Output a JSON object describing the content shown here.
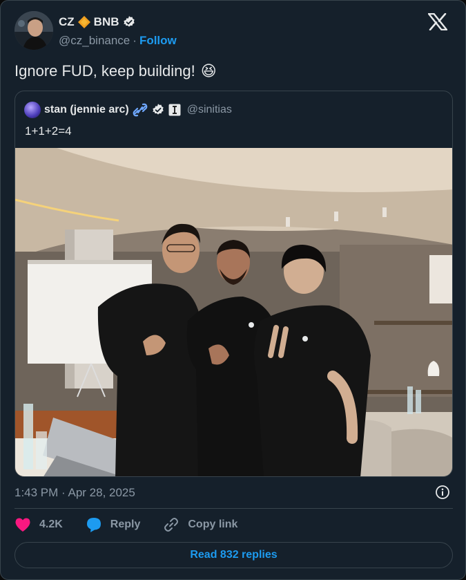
{
  "author": {
    "name": "CZ",
    "name_suffix": "BNB",
    "handle": "@cz_binance",
    "separator": "·",
    "follow_label": "Follow"
  },
  "tweet": {
    "text": "Ignore FUD, keep building!",
    "emoji": "😆"
  },
  "quoted_tweet": {
    "name": "stan (jennie arc)",
    "handle": "@sinitias",
    "text": "1+1+2=4"
  },
  "timestamp": "1:43 PM · Apr 28, 2025",
  "actions": {
    "like_count": "4.2K",
    "reply_label": "Reply",
    "copy_link_label": "Copy link"
  },
  "read_replies_label": "Read 832 replies",
  "colors": {
    "background": "#15202b",
    "border": "#38444d",
    "accent": "#1d9bf0",
    "like": "#f91880",
    "muted": "#8b98a5"
  },
  "icons": [
    "verified-badge-icon",
    "diamond-icon",
    "x-logo-icon",
    "chain-link-icon",
    "info-icon",
    "heart-icon",
    "reply-bubble-icon",
    "link-icon"
  ]
}
